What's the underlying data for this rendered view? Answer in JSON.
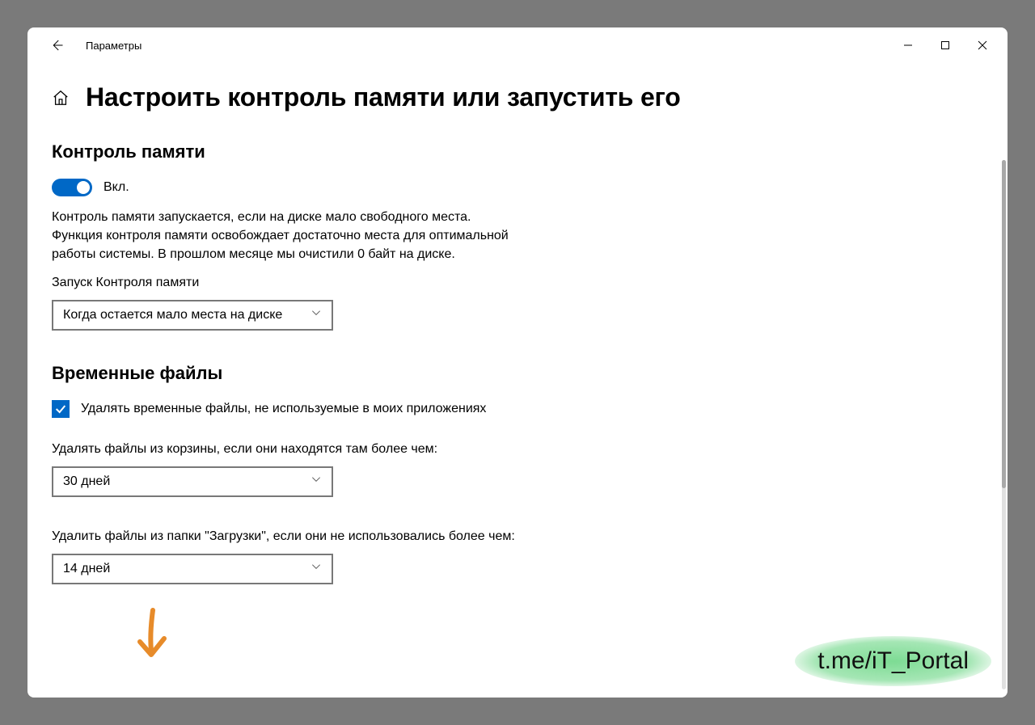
{
  "window": {
    "title": "Параметры"
  },
  "page": {
    "title": "Настроить контроль памяти или запустить его"
  },
  "storage_sense": {
    "heading": "Контроль памяти",
    "toggle_label": "Вкл.",
    "description": "Контроль памяти запускается, если на диске мало свободного места. Функция контроля памяти освобождает достаточно места для оптимальной работы системы. В прошлом месяце мы очистили 0 байт на диске.",
    "run_label": "Запуск Контроля памяти",
    "run_value": "Когда остается мало места на диске"
  },
  "temp_files": {
    "heading": "Временные файлы",
    "checkbox_label": "Удалять временные файлы, не используемые в моих приложениях",
    "recycle_label": "Удалять файлы из корзины, если они находятся там более чем:",
    "recycle_value": "30 дней",
    "downloads_label": "Удалить файлы из папки \"Загрузки\", если они не использовались более чем:",
    "downloads_value": "14 дней"
  },
  "watermark": "t.me/iT_Portal"
}
